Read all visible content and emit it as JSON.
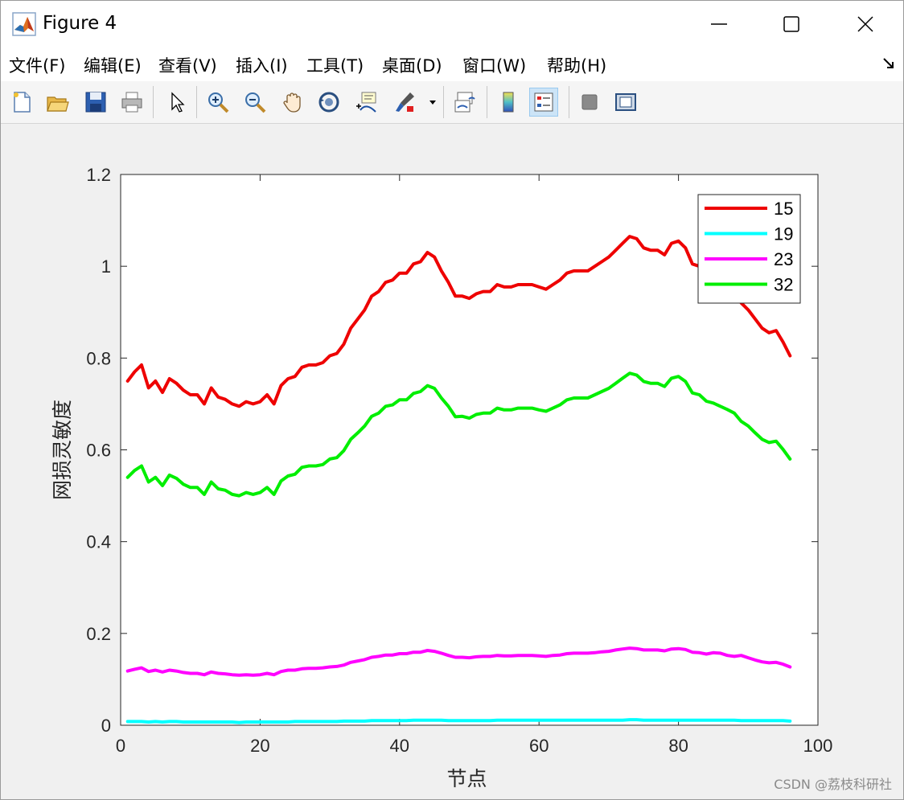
{
  "window": {
    "title": "Figure 4",
    "controls": [
      "minimize-icon",
      "maximize-icon",
      "close-icon"
    ]
  },
  "menu": {
    "items": [
      {
        "label": "文件(F)"
      },
      {
        "label": "编辑(E)"
      },
      {
        "label": "查看(V)"
      },
      {
        "label": "插入(I)"
      },
      {
        "label": "工具(T)"
      },
      {
        "label": "桌面(D)"
      },
      {
        "label": "窗口(W)"
      },
      {
        "label": "帮助(H)"
      }
    ]
  },
  "toolbar": {
    "icons": [
      "new-figure-icon",
      "open-file-icon",
      "save-icon",
      "print-icon",
      "select-arrow-icon",
      "zoom-in-icon",
      "zoom-out-icon",
      "pan-hand-icon",
      "rotate-3d-icon",
      "data-cursor-icon",
      "brush-icon",
      "link-plot-icon",
      "colorbar-icon",
      "legend-icon",
      "hide-tools-icon",
      "show-tools-icon"
    ],
    "active": "legend-icon"
  },
  "watermark": "CSDN @荔枝科研社",
  "chart_data": {
    "type": "line",
    "xlabel": "节点",
    "ylabel": "网损灵敏度",
    "xlim": [
      0,
      100
    ],
    "ylim": [
      0,
      1.2
    ],
    "xticks": [
      "0",
      "20",
      "40",
      "60",
      "80",
      "100"
    ],
    "yticks": [
      "0",
      "0.2",
      "0.4",
      "0.6",
      "0.8",
      "1",
      "1.2"
    ],
    "legend_position": "top-right",
    "grid": false,
    "x": [
      1,
      2,
      3,
      4,
      5,
      6,
      7,
      8,
      9,
      10,
      11,
      12,
      13,
      14,
      15,
      16,
      17,
      18,
      19,
      20,
      21,
      22,
      23,
      24,
      25,
      26,
      27,
      28,
      29,
      30,
      31,
      32,
      33,
      34,
      35,
      36,
      37,
      38,
      39,
      40,
      41,
      42,
      43,
      44,
      45,
      46,
      47,
      48,
      49,
      50,
      51,
      52,
      53,
      54,
      55,
      56,
      57,
      58,
      59,
      60,
      61,
      62,
      63,
      64,
      65,
      66,
      67,
      68,
      69,
      70,
      71,
      72,
      73,
      74,
      75,
      76,
      77,
      78,
      79,
      80,
      81,
      82,
      83,
      84,
      85,
      86,
      87,
      88,
      89,
      90,
      91,
      92,
      93,
      94,
      95,
      96
    ],
    "series": [
      {
        "name": "15",
        "color": "#ee0000",
        "values": [
          0.75,
          0.77,
          0.785,
          0.735,
          0.75,
          0.725,
          0.755,
          0.745,
          0.73,
          0.72,
          0.72,
          0.7,
          0.735,
          0.715,
          0.71,
          0.7,
          0.695,
          0.705,
          0.7,
          0.705,
          0.72,
          0.7,
          0.74,
          0.755,
          0.76,
          0.78,
          0.785,
          0.785,
          0.79,
          0.805,
          0.81,
          0.83,
          0.865,
          0.885,
          0.905,
          0.935,
          0.945,
          0.965,
          0.97,
          0.985,
          0.985,
          1.005,
          1.01,
          1.03,
          1.02,
          0.99,
          0.965,
          0.935,
          0.935,
          0.93,
          0.94,
          0.945,
          0.945,
          0.96,
          0.955,
          0.955,
          0.96,
          0.96,
          0.96,
          0.955,
          0.95,
          0.96,
          0.97,
          0.985,
          0.99,
          0.99,
          0.99,
          1.0,
          1.01,
          1.02,
          1.035,
          1.05,
          1.065,
          1.06,
          1.04,
          1.035,
          1.035,
          1.025,
          1.05,
          1.055,
          1.04,
          1.005,
          1.0,
          0.98,
          0.975,
          0.965,
          0.955,
          0.945,
          0.92,
          0.905,
          0.885,
          0.865,
          0.855,
          0.86,
          0.835,
          0.805
        ]
      },
      {
        "name": "19",
        "color": "#00ffff",
        "values": [
          0.008,
          0.008,
          0.008,
          0.007,
          0.008,
          0.007,
          0.008,
          0.008,
          0.007,
          0.007,
          0.007,
          0.007,
          0.007,
          0.007,
          0.007,
          0.007,
          0.006,
          0.007,
          0.007,
          0.007,
          0.007,
          0.007,
          0.007,
          0.007,
          0.008,
          0.008,
          0.008,
          0.008,
          0.008,
          0.008,
          0.008,
          0.009,
          0.009,
          0.009,
          0.009,
          0.01,
          0.01,
          0.01,
          0.01,
          0.01,
          0.01,
          0.011,
          0.011,
          0.011,
          0.011,
          0.011,
          0.01,
          0.01,
          0.01,
          0.01,
          0.01,
          0.01,
          0.01,
          0.011,
          0.011,
          0.011,
          0.011,
          0.011,
          0.011,
          0.011,
          0.011,
          0.011,
          0.011,
          0.011,
          0.011,
          0.011,
          0.011,
          0.011,
          0.011,
          0.011,
          0.011,
          0.011,
          0.012,
          0.012,
          0.011,
          0.011,
          0.011,
          0.011,
          0.011,
          0.011,
          0.011,
          0.011,
          0.011,
          0.011,
          0.011,
          0.011,
          0.011,
          0.011,
          0.01,
          0.01,
          0.01,
          0.01,
          0.01,
          0.01,
          0.01,
          0.009
        ]
      },
      {
        "name": "23",
        "color": "#ff00ff",
        "values": [
          0.118,
          0.122,
          0.125,
          0.117,
          0.12,
          0.116,
          0.12,
          0.118,
          0.115,
          0.113,
          0.113,
          0.11,
          0.116,
          0.113,
          0.112,
          0.11,
          0.109,
          0.11,
          0.109,
          0.11,
          0.113,
          0.11,
          0.117,
          0.12,
          0.12,
          0.123,
          0.124,
          0.124,
          0.125,
          0.127,
          0.128,
          0.131,
          0.137,
          0.14,
          0.143,
          0.148,
          0.15,
          0.153,
          0.153,
          0.156,
          0.156,
          0.159,
          0.159,
          0.163,
          0.161,
          0.157,
          0.152,
          0.148,
          0.148,
          0.147,
          0.149,
          0.15,
          0.15,
          0.152,
          0.151,
          0.151,
          0.152,
          0.152,
          0.152,
          0.151,
          0.15,
          0.152,
          0.153,
          0.156,
          0.157,
          0.157,
          0.157,
          0.158,
          0.16,
          0.161,
          0.164,
          0.166,
          0.168,
          0.167,
          0.164,
          0.164,
          0.164,
          0.162,
          0.166,
          0.167,
          0.165,
          0.159,
          0.158,
          0.155,
          0.158,
          0.157,
          0.152,
          0.15,
          0.152,
          0.147,
          0.142,
          0.138,
          0.136,
          0.137,
          0.133,
          0.127
        ]
      },
      {
        "name": "32",
        "color": "#00ee00",
        "values": [
          0.54,
          0.555,
          0.565,
          0.53,
          0.54,
          0.522,
          0.545,
          0.538,
          0.525,
          0.518,
          0.518,
          0.503,
          0.53,
          0.515,
          0.512,
          0.503,
          0.5,
          0.507,
          0.503,
          0.507,
          0.518,
          0.503,
          0.532,
          0.543,
          0.547,
          0.562,
          0.565,
          0.565,
          0.568,
          0.58,
          0.583,
          0.598,
          0.623,
          0.637,
          0.652,
          0.673,
          0.68,
          0.695,
          0.698,
          0.709,
          0.709,
          0.723,
          0.727,
          0.74,
          0.734,
          0.713,
          0.695,
          0.672,
          0.673,
          0.669,
          0.677,
          0.68,
          0.68,
          0.691,
          0.687,
          0.687,
          0.691,
          0.691,
          0.691,
          0.687,
          0.684,
          0.691,
          0.698,
          0.709,
          0.713,
          0.713,
          0.713,
          0.72,
          0.727,
          0.734,
          0.745,
          0.756,
          0.767,
          0.763,
          0.749,
          0.745,
          0.745,
          0.738,
          0.756,
          0.76,
          0.749,
          0.724,
          0.72,
          0.706,
          0.702,
          0.695,
          0.688,
          0.68,
          0.662,
          0.652,
          0.637,
          0.623,
          0.616,
          0.619,
          0.601,
          0.58
        ]
      }
    ]
  }
}
